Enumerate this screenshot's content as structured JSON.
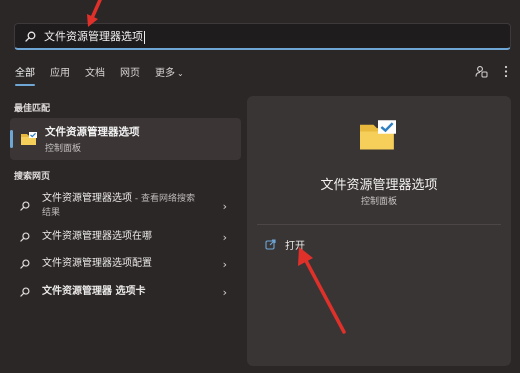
{
  "search": {
    "query": "文件资源管理器选项"
  },
  "tabs": [
    {
      "label": "全部",
      "active": true
    },
    {
      "label": "应用",
      "active": false
    },
    {
      "label": "文档",
      "active": false
    },
    {
      "label": "网页",
      "active": false
    },
    {
      "label": "更多",
      "active": false
    }
  ],
  "top_icons": [
    "account-switch-icon",
    "more-options-icon"
  ],
  "best_match": {
    "heading": "最佳匹配",
    "title": "文件资源管理器选项",
    "subtitle": "控制面板",
    "icon": "folder-check-icon"
  },
  "web_search": {
    "heading": "搜索网页",
    "items": [
      {
        "text": "文件资源管理器选项",
        "suffix": " - 查看网络搜索",
        "line2": "结果"
      },
      {
        "text": "文件资源管理器选项在哪"
      },
      {
        "text": "文件资源管理器选项配置"
      },
      {
        "text": "文件资源管理器 选项卡"
      }
    ]
  },
  "preview": {
    "title": "文件资源管理器选项",
    "subtitle": "控制面板",
    "action_label": "打开"
  },
  "colors": {
    "accent": "#6ea6d6",
    "annotation_arrow": "#e0302a",
    "background": "#2b2727",
    "panel": "#3a3535"
  }
}
